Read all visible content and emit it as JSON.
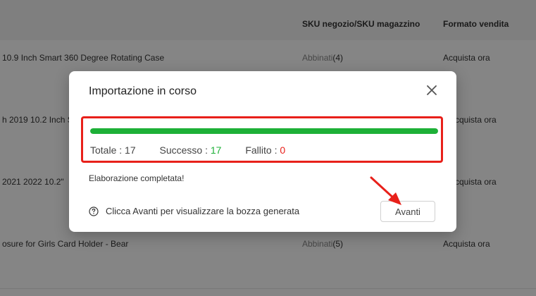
{
  "table": {
    "headers": {
      "sku": "SKU negozio/SKU magazzino",
      "format": "Formato vendita"
    },
    "rows": [
      {
        "title": "10.9 Inch Smart 360 Degree Rotating Case",
        "match_label": "Abbinati",
        "match_count": "(4)",
        "format": "Acquista ora"
      },
      {
        "title": "h 2019 10.2 Inch S",
        "match_label": "",
        "match_count": "",
        "format": "cquista ora"
      },
      {
        "title": "2021 2022 10.2\"",
        "match_label": "",
        "match_count": "",
        "format": "cquista ora"
      },
      {
        "title": "osure for Girls Card Holder - Bear",
        "match_label": "Abbinati",
        "match_count": "(5)",
        "format": "Acquista ora"
      }
    ]
  },
  "modal": {
    "title": "Importazione in corso",
    "progress_fraction": 1.0,
    "stats": {
      "total_label": "Totale",
      "total_value": "17",
      "success_label": "Successo",
      "success_value": "17",
      "failed_label": "Fallito",
      "failed_value": "0"
    },
    "done_message": "Elaborazione completata!",
    "hint": "Clicca Avanti per visualizzare la bozza generata",
    "next_button": "Avanti"
  },
  "colors": {
    "success": "#1db037",
    "failed": "#e8201a",
    "annotation": "#e8201a"
  },
  "icons": {
    "close": "close-icon",
    "help": "question-circle-icon",
    "annotation": "red-arrow"
  }
}
